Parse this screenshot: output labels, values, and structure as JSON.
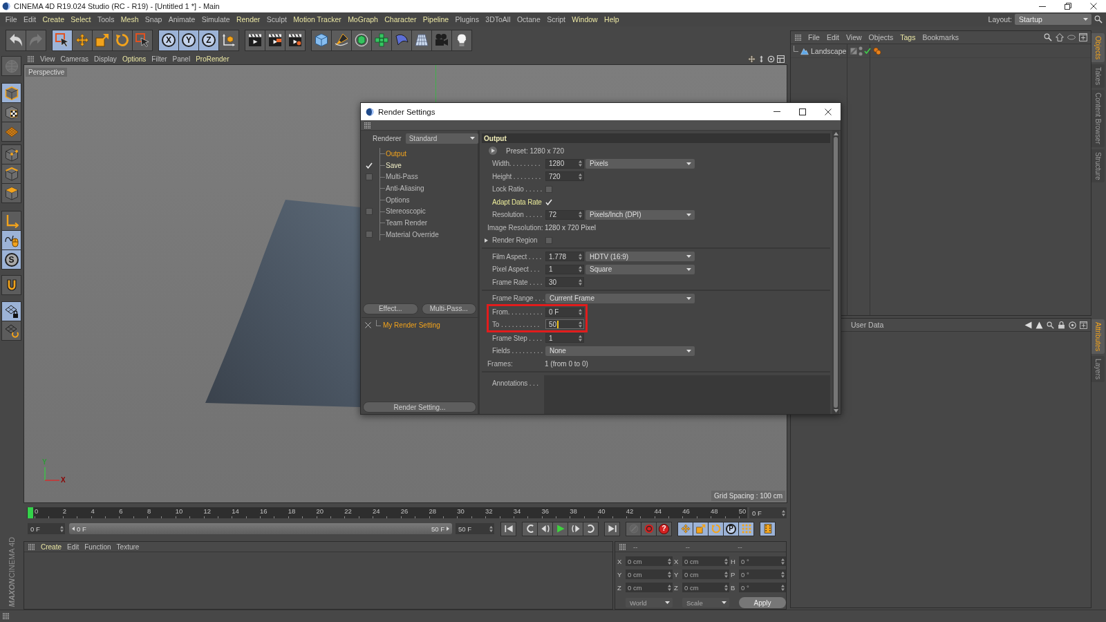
{
  "window": {
    "title": "CINEMA 4D R19.024 Studio (RC - R19) - [Untitled 1 *] - Main"
  },
  "menu_bar": [
    {
      "label": "File",
      "highlighted": false
    },
    {
      "label": "Edit",
      "highlighted": false
    },
    {
      "label": "Create",
      "highlighted": true
    },
    {
      "label": "Select",
      "highlighted": true
    },
    {
      "label": "Tools",
      "highlighted": false
    },
    {
      "label": "Mesh",
      "highlighted": true
    },
    {
      "label": "Snap",
      "highlighted": false
    },
    {
      "label": "Animate",
      "highlighted": false
    },
    {
      "label": "Simulate",
      "highlighted": false
    },
    {
      "label": "Render",
      "highlighted": true
    },
    {
      "label": "Sculpt",
      "highlighted": false
    },
    {
      "label": "Motion Tracker",
      "highlighted": true
    },
    {
      "label": "MoGraph",
      "highlighted": true
    },
    {
      "label": "Character",
      "highlighted": true
    },
    {
      "label": "Pipeline",
      "highlighted": true
    },
    {
      "label": "Plugins",
      "highlighted": false
    },
    {
      "label": "3DToAll",
      "highlighted": false
    },
    {
      "label": "Octane",
      "highlighted": false
    },
    {
      "label": "Script",
      "highlighted": false
    },
    {
      "label": "Window",
      "highlighted": true
    },
    {
      "label": "Help",
      "highlighted": true
    }
  ],
  "layout": {
    "label": "Layout:",
    "value": "Startup"
  },
  "toolbar": [
    [
      {
        "selected": false,
        "disabled": false
      },
      {
        "selected": false,
        "disabled": true
      }
    ],
    [
      {
        "selected": true,
        "disabled": false
      },
      {
        "selected": false,
        "disabled": false
      },
      {
        "selected": false,
        "disabled": false
      },
      {
        "selected": false,
        "disabled": false
      },
      {
        "selected": false,
        "disabled": false
      }
    ],
    [
      {
        "label": "X",
        "selected": true,
        "disabled": false
      },
      {
        "label": "Y",
        "selected": true,
        "disabled": false
      },
      {
        "label": "Z",
        "selected": true,
        "disabled": false
      },
      {
        "selected": false,
        "disabled": false
      }
    ],
    [
      {
        "selected": false,
        "disabled": false
      },
      {
        "selected": false,
        "disabled": false
      },
      {
        "selected": false,
        "disabled": false
      }
    ],
    [
      {
        "selected": false,
        "disabled": false
      },
      {
        "selected": false,
        "disabled": false
      },
      {
        "selected": false,
        "disabled": false
      },
      {
        "selected": false,
        "disabled": false
      },
      {
        "selected": false,
        "disabled": false
      },
      {
        "selected": false,
        "disabled": false
      },
      {
        "selected": false,
        "disabled": false
      },
      {
        "selected": false,
        "disabled": false
      }
    ]
  ],
  "left_toolbar": [
    [
      {
        "selected": false,
        "disabled": true
      }
    ],
    [
      {
        "selected": true,
        "disabled": false
      },
      {
        "selected": false,
        "disabled": false
      },
      {
        "selected": false,
        "disabled": false
      }
    ],
    [
      {
        "selected": false,
        "disabled": false
      },
      {
        "selected": false,
        "disabled": false
      },
      {
        "selected": false,
        "disabled": false
      }
    ],
    [
      {
        "selected": false,
        "disabled": false
      },
      {
        "selected": true,
        "disabled": false
      },
      {
        "label": "S",
        "selected": true,
        "disabled": false
      }
    ],
    [
      {
        "selected": false,
        "disabled": false
      }
    ],
    [
      {
        "selected": true,
        "disabled": false
      },
      {
        "selected": false,
        "disabled": false
      }
    ]
  ],
  "viewport": {
    "menu": [
      {
        "label": "View",
        "highlighted": false
      },
      {
        "label": "Cameras",
        "highlighted": false
      },
      {
        "label": "Display",
        "highlighted": false
      },
      {
        "label": "Options",
        "highlighted": true
      },
      {
        "label": "Filter",
        "highlighted": false
      },
      {
        "label": "Panel",
        "highlighted": false
      },
      {
        "label": "ProRender",
        "highlighted": true
      }
    ],
    "camera": "Perspective",
    "grid_spacing": "Grid Spacing : 100 cm",
    "axis_labels": [
      "Y",
      "X"
    ]
  },
  "timeline": {
    "ruler": [
      "0",
      "2",
      "4",
      "6",
      "8",
      "10",
      "12",
      "14",
      "16",
      "18",
      "20",
      "22",
      "24",
      "26",
      "28",
      "30",
      "32",
      "34",
      "36",
      "38",
      "40",
      "42",
      "44",
      "46",
      "48",
      "50"
    ],
    "playhead": {
      "level": 0
    },
    "current_frame": "0 F",
    "start": "0 F",
    "range": {
      "start": "0 F",
      "end": "50 F"
    },
    "end": "50 F"
  },
  "transport": [
    [
      {
        "selected": false,
        "disabled": false
      }
    ],
    [
      {
        "selected": false,
        "disabled": false
      },
      {
        "selected": false,
        "disabled": false
      },
      {
        "selected": false,
        "disabled": false
      },
      {
        "selected": false,
        "disabled": false
      },
      {
        "selected": false,
        "disabled": false
      }
    ],
    [
      {
        "selected": false,
        "disabled": false
      }
    ],
    [
      {
        "selected": false,
        "disabled": true
      },
      {
        "selected": false,
        "disabled": false
      },
      {
        "label": "?",
        "selected": false,
        "disabled": false
      }
    ],
    [
      {
        "selected": true,
        "disabled": false
      },
      {
        "selected": true,
        "disabled": false
      },
      {
        "selected": true,
        "disabled": false
      },
      {
        "label": "P",
        "selected": true,
        "disabled": false
      },
      {
        "selected": true,
        "disabled": false
      }
    ],
    [
      {
        "selected": true,
        "disabled": false
      }
    ]
  ],
  "material_manager": {
    "menu": [
      {
        "label": "Create",
        "highlighted": true
      },
      {
        "label": "Edit",
        "highlighted": false
      },
      {
        "label": "Function",
        "highlighted": false
      },
      {
        "label": "Texture",
        "highlighted": false
      }
    ]
  },
  "coordinates": {
    "columns": [
      "--",
      "--",
      "--"
    ],
    "rows": [
      [
        {
          "axis": "X",
          "value": "0 cm"
        },
        {
          "axis": "X",
          "value": "0 cm"
        },
        {
          "axis": "H",
          "value": "0 °"
        }
      ],
      [
        {
          "axis": "Y",
          "value": "0 cm"
        },
        {
          "axis": "Y",
          "value": "0 cm"
        },
        {
          "axis": "P",
          "value": "0 °"
        }
      ],
      [
        {
          "axis": "Z",
          "value": "0 cm"
        },
        {
          "axis": "Z",
          "value": "0 cm"
        },
        {
          "axis": "B",
          "value": "0 °"
        }
      ]
    ],
    "dropdowns": [
      "World",
      "Scale"
    ],
    "apply": "Apply",
    "disabled": true
  },
  "logo": {
    "brand": "MAXON",
    "product": "CINEMA 4D"
  },
  "object_manager": {
    "menu": [
      {
        "label": "File",
        "highlighted": false
      },
      {
        "label": "Edit",
        "highlighted": false
      },
      {
        "label": "View",
        "highlighted": false
      },
      {
        "label": "Objects",
        "highlighted": false
      },
      {
        "label": "Tags",
        "highlighted": true
      },
      {
        "label": "Bookmarks",
        "highlighted": false
      }
    ],
    "objects": [
      {
        "name": "Landscape"
      }
    ]
  },
  "attribute_manager": {
    "menu": [
      {
        "label": "User Data",
        "highlighted": false
      }
    ]
  },
  "side_tabs": [
    [
      {
        "label": "Objects",
        "selected": true
      },
      {
        "label": "Takes",
        "selected": false
      },
      {
        "label": "Content Browser",
        "selected": false
      },
      {
        "label": "Structure",
        "selected": false
      }
    ],
    [
      {
        "label": "Attributes",
        "selected": true
      },
      {
        "label": "Layers",
        "selected": false
      }
    ]
  ],
  "render_settings": {
    "title": "Render Settings",
    "renderer": {
      "label": "Renderer",
      "value": "Standard"
    },
    "tree": [
      {
        "label": "Output",
        "kind": "page",
        "selected": true
      },
      {
        "label": "Save",
        "kind": "toggle",
        "checked": true,
        "selected": false
      },
      {
        "label": "Multi-Pass",
        "kind": "toggle",
        "checked": false,
        "selected": false
      },
      {
        "label": "Anti-Aliasing",
        "kind": "page",
        "selected": false
      },
      {
        "label": "Options",
        "kind": "page",
        "selected": false
      },
      {
        "label": "Stereoscopic",
        "kind": "toggle",
        "checked": false,
        "selected": false
      },
      {
        "label": "Team Render",
        "kind": "page",
        "selected": false
      },
      {
        "label": "Material Override",
        "kind": "toggle",
        "checked": false,
        "selected": false
      }
    ],
    "buttons": [
      "Effect...",
      "Multi-Pass..."
    ],
    "presets": [
      {
        "label": "My Render Setting",
        "selected": true
      }
    ],
    "footer_button": "Render Setting...",
    "section_title": "Output",
    "sections": [
      [
        {
          "kind": "preset",
          "label": "Preset: 1280 x 720"
        },
        {
          "kind": "number",
          "label": "Width. . . . . . . . .",
          "value": "1280",
          "unit": "Pixels",
          "focused": false
        },
        {
          "kind": "number",
          "label": "Height . . . . . . . .",
          "value": "720",
          "focused": false
        },
        {
          "kind": "checkbox",
          "label": "Lock Ratio . . . . .",
          "checked": false
        },
        {
          "kind": "checkbox",
          "label": "Adapt Data Rate",
          "checked": true
        },
        {
          "kind": "number",
          "label": "Resolution . . . . .",
          "value": "72",
          "unit": "Pixels/Inch (DPI)",
          "focused": false
        },
        {
          "kind": "info",
          "label": "Image Resolution:",
          "value": "1280 x 720 Pixel"
        },
        {
          "kind": "checkbox",
          "label": "Render Region",
          "checked": false,
          "expanded": false
        }
      ],
      [
        {
          "kind": "number",
          "label": "Film Aspect . . . .",
          "value": "1.778",
          "unit": "HDTV (16:9)",
          "focused": false
        },
        {
          "kind": "number",
          "label": "Pixel Aspect . . .",
          "value": "1",
          "unit": "Square",
          "focused": false
        },
        {
          "kind": "number",
          "label": "Frame Rate . . . .",
          "value": "30",
          "focused": false
        }
      ],
      [
        {
          "kind": "dropdown",
          "label": "Frame Range . . .",
          "value": "Current Frame"
        },
        {
          "kind": "group",
          "marked": true,
          "rows": [
            {
              "kind": "number",
              "label": "From. . . . . . . . . .",
              "value": "0 F",
              "focused": false
            },
            {
              "kind": "number",
              "label": "To . . . . . . . . . . .",
              "value": "50",
              "focused": true
            }
          ]
        },
        {
          "kind": "number",
          "label": "Frame Step . . . .",
          "value": "1",
          "focused": false
        },
        {
          "kind": "dropdown",
          "label": "Fields . . . . . . . . .",
          "value": "None"
        },
        {
          "kind": "info",
          "label": "Frames:",
          "value": "1 (from 0 to 0)"
        }
      ],
      [
        {
          "kind": "textarea",
          "label": "Annotations . . ."
        }
      ]
    ]
  }
}
